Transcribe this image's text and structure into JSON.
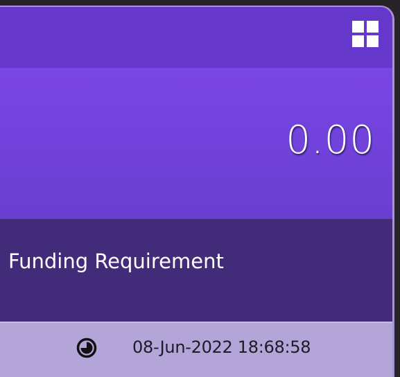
{
  "widget": {
    "value": "0.00",
    "label": "Funding Requirement",
    "timestamp": "08-Jun-2022 18:68:58",
    "icons": {
      "menu": "grid-icon",
      "time": "clock-icon"
    },
    "colors": {
      "header": "#6538cb",
      "value_band": "#7a46e6",
      "label_band": "#422c7a",
      "footer": "#b3a5d8"
    }
  }
}
